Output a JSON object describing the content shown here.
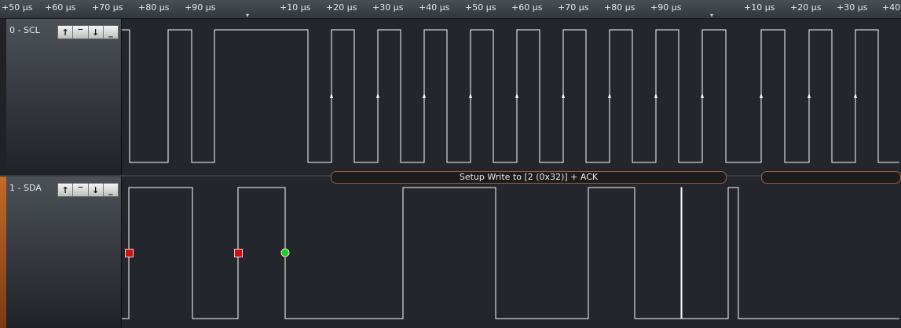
{
  "ruler": {
    "ticks": [
      "+50 µs",
      "+60 µs",
      "+70 µs",
      "+80 µs",
      "+90 µs",
      "+10 µs",
      "+20 µs",
      "+30 µs",
      "+40 µs",
      "+50 µs",
      "+60 µs",
      "+70 µs",
      "+80 µs",
      "+90 µs",
      "+10 µs",
      "+20 µs",
      "+30 µs",
      "+40"
    ]
  },
  "channels": [
    {
      "label": "0 - SCL",
      "accent": "#202226"
    },
    {
      "label": "1 - SDA",
      "accent": "#a8561c"
    }
  ],
  "trigger_buttons": [
    "rising-edge-icon",
    "high-level-icon",
    "falling-edge-icon",
    "low-level-icon"
  ],
  "trigger_glyphs": [
    "↑",
    "‾",
    "↓",
    "_"
  ],
  "protocol": {
    "frame1": "Setup Write to [2 (0x32)] + ACK",
    "frame2": ""
  },
  "colors": {
    "trace": "#ffffff",
    "start_marker": "#cc1111",
    "data_marker": "#22cc22",
    "background": "#23262c"
  }
}
